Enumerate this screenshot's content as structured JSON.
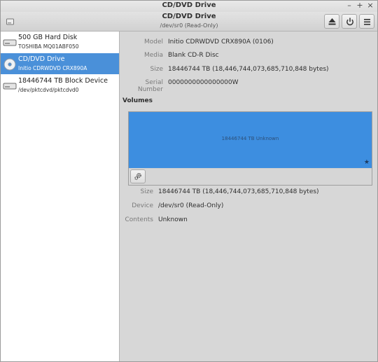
{
  "window": {
    "title": "CD/DVD Drive"
  },
  "header": {
    "title": "CD/DVD Drive",
    "subtitle": "/dev/sr0 (Read-Only)"
  },
  "sidebar": {
    "items": [
      {
        "name": "500 GB Hard Disk",
        "sub": "TOSHIBA MQ01ABF050",
        "icon": "hard-disk-icon",
        "selected": false
      },
      {
        "name": "CD/DVD Drive",
        "sub": "Initio CDRWDVD CRX890A",
        "icon": "optical-disc-icon",
        "selected": true
      },
      {
        "name": "18446744 TB Block Device",
        "sub": "/dev/pktcdvd/pktcdvd0",
        "icon": "block-device-icon",
        "selected": false
      }
    ]
  },
  "drive": {
    "model_label": "Model",
    "model": "Initio CDRWDVD CRX890A (0106)",
    "media_label": "Media",
    "media": "Blank CD-R Disc",
    "size_label": "Size",
    "size": "18446744 TB (18,446,744,073,685,710,848 bytes)",
    "serial_label": "Serial Number",
    "serial": "0000000000000000W"
  },
  "volumes": {
    "heading": "Volumes",
    "bar_label": "18446744 TB Unknown",
    "size_label": "Size",
    "size": "18446744 TB (18,446,744,073,685,710,848 bytes)",
    "device_label": "Device",
    "device": "/dev/sr0 (Read-Only)",
    "contents_label": "Contents",
    "contents": "Unknown"
  },
  "colors": {
    "selection": "#4a90d9",
    "volume_bar": "#3d8ee0"
  }
}
